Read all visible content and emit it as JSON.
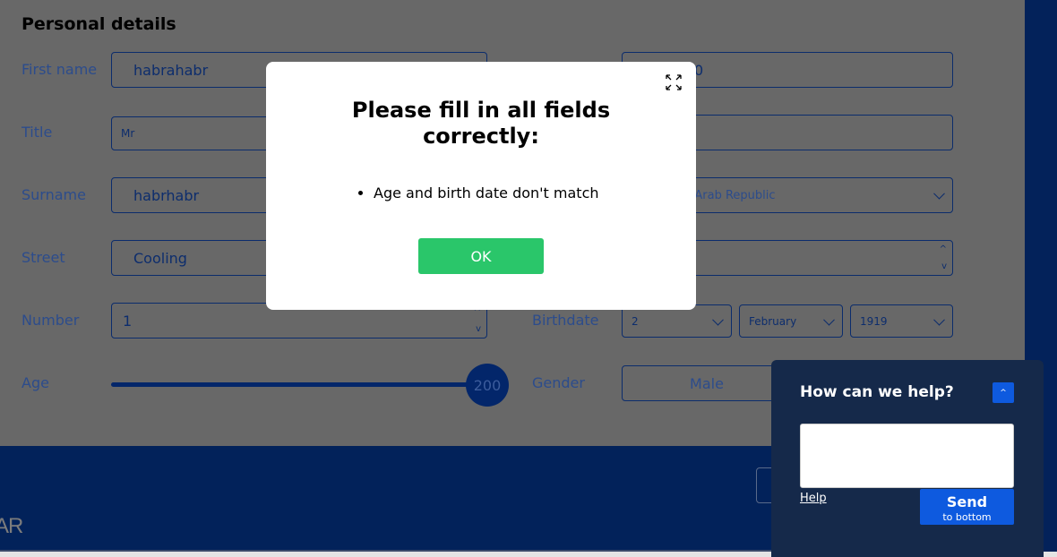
{
  "form": {
    "heading": "Personal details",
    "first_name": {
      "label": "First name",
      "value": "habrahabr"
    },
    "title": {
      "label": "Title",
      "value": "Mr"
    },
    "surname": {
      "label": "Surname",
      "value": "habrhabr"
    },
    "street": {
      "label": "Street",
      "value": "Cooling"
    },
    "number": {
      "label": "Number",
      "value": "1"
    },
    "age": {
      "label": "Age",
      "value": "200",
      "slider_fraction": 1.0
    },
    "right_field_1_value": "0",
    "right_field_2_value": "",
    "country_value": "n Arab Republic",
    "birthdate": {
      "label": "Birthdate",
      "day": "2",
      "month": "February",
      "year": "1919"
    },
    "gender": {
      "label": "Gender",
      "value": "Male"
    }
  },
  "footer": {
    "logo_text": "AR"
  },
  "modal": {
    "title": "Please fill in all fields correctly:",
    "errors": [
      "Age and birth date don't match"
    ],
    "ok_label": "OK",
    "expand_icon": "expand-icon"
  },
  "chat": {
    "title": "How can we help?",
    "toggle_label": "^",
    "help_link": "Help",
    "send_label": "Send",
    "send_sub": "to bottom",
    "colors": {
      "panel": "#15294a",
      "button": "#0e5adf"
    }
  },
  "colors": {
    "overlay": "#686868",
    "brand": "#02225a",
    "ok": "#2ac66a"
  }
}
